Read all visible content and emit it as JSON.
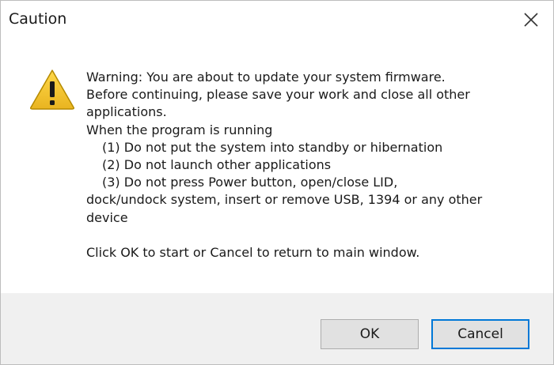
{
  "window": {
    "title": "Caution"
  },
  "icons": {
    "warning": "warning-triangle-icon",
    "close": "close-icon"
  },
  "colors": {
    "warning_fill": "#f2c530",
    "warning_border": "#b58a00",
    "footer_bg": "#f0f0f0",
    "focus_border": "#0078d7"
  },
  "message": {
    "line1": "Warning: You are about to update your system firmware.",
    "line2": "Before continuing, please save your work and close all other",
    "line3": "applications.",
    "line4": "When the program is running",
    "item1": "(1) Do not put the system into standby or hibernation",
    "item2": "(2) Do not launch other applications",
    "item3a": "(3) Do not press Power button, open/close LID,",
    "item3b": "dock/undock system, insert or remove USB, 1394 or any other",
    "item3c": "device",
    "footer_text": "Click OK to start or Cancel to return to main window."
  },
  "buttons": {
    "ok_label": "OK",
    "cancel_label": "Cancel"
  }
}
